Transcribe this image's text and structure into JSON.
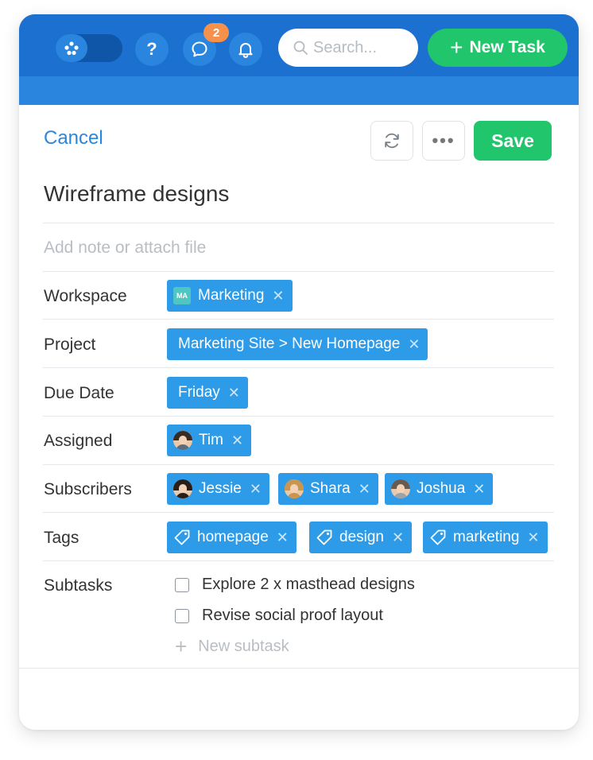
{
  "header": {
    "notification_count": "2",
    "search_placeholder": "Search...",
    "new_task_label": "New Task",
    "help_label": "?"
  },
  "toolbar": {
    "cancel_label": "Cancel",
    "more_label": "•••",
    "save_label": "Save"
  },
  "task": {
    "title": "Wireframe designs",
    "note_placeholder": "Add note or attach file"
  },
  "fields": {
    "workspace": {
      "label": "Workspace",
      "badge": "MA",
      "value": "Marketing"
    },
    "project": {
      "label": "Project",
      "value": "Marketing Site > New Homepage"
    },
    "due_date": {
      "label": "Due Date",
      "value": "Friday"
    },
    "assigned": {
      "label": "Assigned",
      "value": "Tim"
    },
    "subscribers": {
      "label": "Subscribers",
      "values": [
        "Jessie",
        "Shara",
        "Joshua"
      ]
    },
    "tags": {
      "label": "Tags",
      "values": [
        "homepage",
        "design",
        "marketing"
      ]
    },
    "subtasks": {
      "label": "Subtasks",
      "items": [
        "Explore 2 x masthead designs",
        "Revise social proof layout"
      ],
      "new_label": "New subtask"
    }
  },
  "colors": {
    "header_dark": "#1c70cf",
    "header_light": "#2a85de",
    "accent_green": "#21c56b",
    "chip_blue": "#2e9be8",
    "badge_orange": "#f6914b",
    "link_blue": "#2a87de"
  },
  "icons": {
    "toggle": "dots-logo-icon",
    "help": "question-icon",
    "chat": "chat-bubble-icon",
    "bell": "bell-icon",
    "search": "search-icon",
    "refresh": "refresh-icon",
    "tag": "tag-icon",
    "remove": "close-icon"
  }
}
